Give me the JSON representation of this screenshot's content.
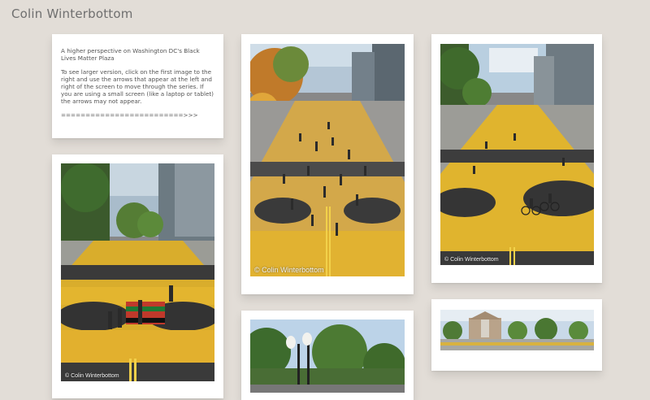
{
  "header": {
    "site_title": "Colin Winterbottom"
  },
  "intro": {
    "heading": "A higher perspective on Washington DC's Black Lives Matter Plaza",
    "instructions": "To see larger version, click on the first image to the right and use the arrows that appear at the left and right of the screen to move through the series. If you are using a small screen (like a laptop or tablet) the arrows may not appear.",
    "arrow": "=========================>>>"
  },
  "photos": [
    {
      "watermark": "© Colin Winterbottom"
    },
    {
      "watermark": "© Colin Winterbottom"
    },
    {
      "watermark": "© Colin Winterbottom"
    },
    {
      "watermark": ""
    },
    {
      "watermark": ""
    }
  ]
}
